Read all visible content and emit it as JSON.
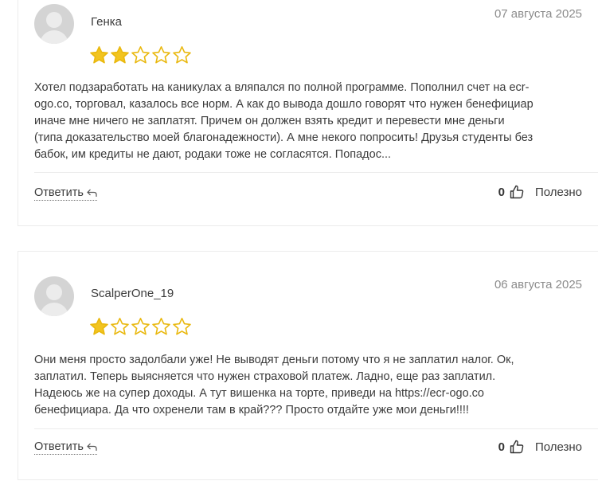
{
  "reviews": [
    {
      "author": "Генка",
      "date": "07 августа 2025",
      "rating": 2,
      "max_rating": 5,
      "text_lines": [
        "Хотел подзаработать на каникулах а вляпался по полной программе. Пополнил счет на ecr-",
        "ogo.co, торговал, казалось все норм. А как до вывода дошло говорят что нужен бенефициар",
        "иначе мне ничего не заплатят. Причем он должен взять кредит и перевести мне деньги",
        "(типа доказательство моей благонадежности). А мне некого попросить! Друзья студенты без",
        "бабок, им кредиты не дают, родаки тоже не согласятся. Попадос..."
      ],
      "reply_label": "Ответить",
      "like_count": "0",
      "useful_label": "Полезно"
    },
    {
      "author": "ScalperOne_19",
      "date": "06 августа 2025",
      "rating": 1,
      "max_rating": 5,
      "text_lines": [
        "Они меня просто задолбали уже! Не выводят деньги потому что я не заплатил налог. Ок,",
        "заплатил. Теперь выясняется что нужен страховой платеж. Ладно, еще раз заплатил.",
        "Надеюсь же на супер доходы. А тут вишенка на торте, приведи на https://ecr-ogo.co",
        "бенефициара. Да что охренели там в край??? Просто отдайте уже мои деньги!!!!"
      ],
      "reply_label": "Ответить",
      "like_count": "0",
      "useful_label": "Полезно"
    }
  ],
  "colors": {
    "star_filled": "#f2c41f",
    "star_outline": "#e9b80e",
    "avatar_bg": "#d4d4d4"
  },
  "icons": {
    "avatar": "user-placeholder-icon",
    "star": "star-icon",
    "reply": "reply-arrow-icon",
    "like": "thumbs-up-icon"
  }
}
